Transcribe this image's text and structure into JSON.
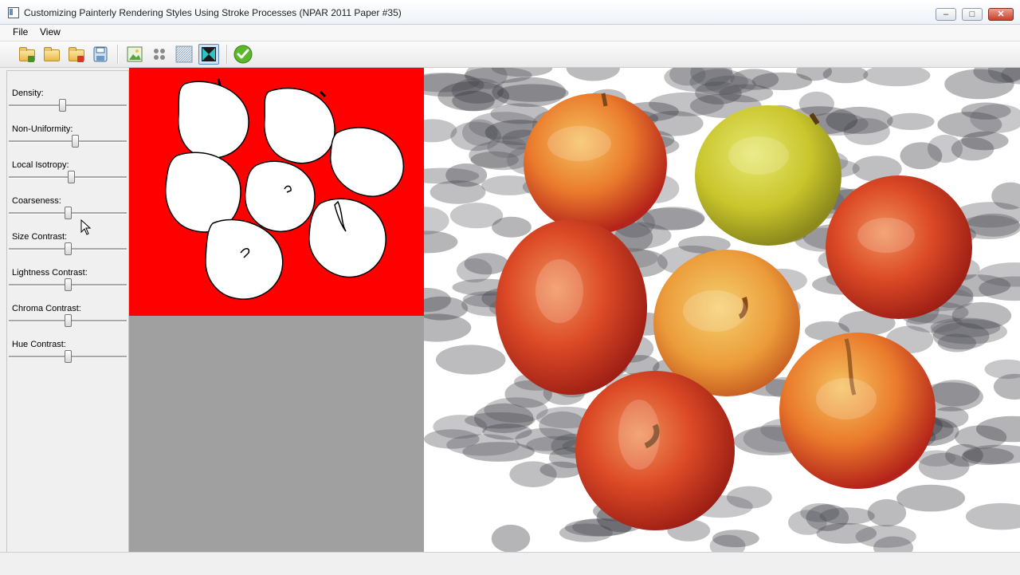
{
  "window": {
    "title": "Customizing Painterly Rendering Styles Using Stroke Processes (NPAR 2011 Paper #35)",
    "minimize_glyph": "–",
    "maximize_glyph": "□",
    "close_glyph": "✕"
  },
  "menu": {
    "items": [
      {
        "label": "File"
      },
      {
        "label": "View"
      }
    ]
  },
  "toolbar": {
    "buttons": [
      {
        "icon": "open-folder-icon"
      },
      {
        "icon": "open-folder-icon"
      },
      {
        "icon": "open-folder-icon"
      },
      {
        "icon": "save-disk-icon"
      },
      {
        "icon": "load-image-icon"
      },
      {
        "icon": "dots-icon"
      },
      {
        "icon": "texture-icon"
      },
      {
        "icon": "mask-icon",
        "active": true
      },
      {
        "icon": "checkmark-icon"
      }
    ]
  },
  "sliders": [
    {
      "label": "Density:",
      "value": 0.45
    },
    {
      "label": "Non-Uniformity:",
      "value": 0.57
    },
    {
      "label": "Local Isotropy:",
      "value": 0.53
    },
    {
      "label": "Coarseness:",
      "value": 0.5
    },
    {
      "label": "Size Contrast:",
      "value": 0.5
    },
    {
      "label": "Lightness Contrast:",
      "value": 0.5
    },
    {
      "label": "Chroma Contrast:",
      "value": 0.5
    },
    {
      "label": "Hue Contrast:",
      "value": 0.5
    }
  ],
  "colors": {
    "mask_background": "#ff0000",
    "mask_foreground": "#ffffff",
    "empty_area": "#a0a0a0",
    "accent_check": "#5cb82a"
  }
}
